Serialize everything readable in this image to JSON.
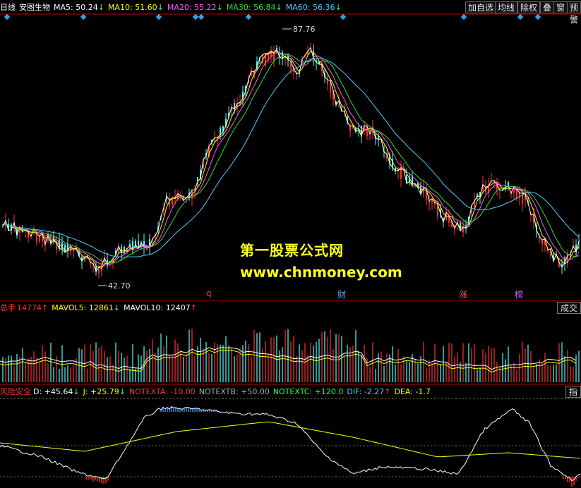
{
  "header": {
    "period": "日线",
    "stock_name": "安图生物",
    "ma": [
      {
        "label": "MA5: 50.24",
        "arrow": "↓",
        "color": "#ffffff"
      },
      {
        "label": "MA10: 51.60",
        "arrow": "↓",
        "color": "#ffff00"
      },
      {
        "label": "MA20: 55.22",
        "arrow": "↓",
        "color": "#ff55ff"
      },
      {
        "label": "MA30: 56.84",
        "arrow": "↓",
        "color": "#33dd33"
      },
      {
        "label": "MA60: 56.36",
        "arrow": "↓",
        "color": "#55ccff"
      }
    ],
    "buttons": [
      "加自选",
      "均线",
      "除权",
      "叠",
      "窗",
      "预警"
    ]
  },
  "price_chart": {
    "high_label": "87.76",
    "low_label": "42.70"
  },
  "watermark": {
    "line1": "第一股票公式网",
    "line2": "www.chnmoney.com"
  },
  "events": [
    {
      "label": "q",
      "color": "#ff3333"
    },
    {
      "label": "财",
      "color": "#55aaff"
    },
    {
      "label": "涨",
      "color": "#ff5555"
    },
    {
      "label": "榜",
      "color": "#cc66ff"
    }
  ],
  "volume": {
    "label": "总手",
    "value": "14774",
    "value_arrow": "↑",
    "mavol5": "MAVOL5: 12861",
    "mavol5_arrow": "↓",
    "mavol10": "MAVOL10: 12407",
    "mavol10_arrow": "↑",
    "side_tab": "成交"
  },
  "indicator": {
    "name": "风险安全",
    "items": [
      {
        "label": "D: +45.64",
        "arrow": "↓",
        "color": "#ffffff"
      },
      {
        "label": "J: +25.79",
        "arrow": "↓",
        "color": "#ffff00"
      },
      {
        "label": "NOTEXTA: -10.00",
        "arrow": "",
        "color": "#ff3333"
      },
      {
        "label": "NOTEXTB: +50.00",
        "arrow": "",
        "color": "#aaaaaa"
      },
      {
        "label": "NOTEXTC: +120.0",
        "arrow": "",
        "color": "#33ff33"
      },
      {
        "label": "DIF: -2.27",
        "arrow": "↑",
        "color": "#55ccff"
      },
      {
        "label": "DEA: -1.7",
        "arrow": "",
        "color": "#ffff00"
      }
    ],
    "side_tab": "指"
  },
  "colors": {
    "up": "#ff3333",
    "down": "#54ffff",
    "frame": "#b00000"
  }
}
